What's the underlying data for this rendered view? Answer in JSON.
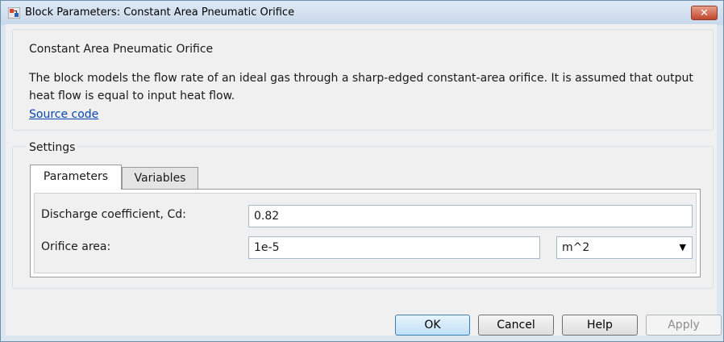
{
  "window": {
    "title": "Block Parameters: Constant Area Pneumatic Orifice",
    "close_glyph": "✕",
    "close_color": "#c75050"
  },
  "block": {
    "name": "Constant Area Pneumatic Orifice",
    "description": "The block models the flow rate of an ideal gas through a sharp-edged constant-area orifice. It is assumed that output heat flow is equal to input heat flow.",
    "source_link": "Source code"
  },
  "settings": {
    "legend": "Settings",
    "tabs": [
      {
        "label": "Parameters",
        "active": true
      },
      {
        "label": "Variables",
        "active": false
      }
    ],
    "params": [
      {
        "label": "Discharge coefficient, Cd:",
        "value": "0.82"
      },
      {
        "label": "Orifice area:",
        "value": "1e-5",
        "unit": "m^2"
      }
    ]
  },
  "buttons": {
    "ok": "OK",
    "cancel": "Cancel",
    "help": "Help",
    "apply": "Apply"
  }
}
